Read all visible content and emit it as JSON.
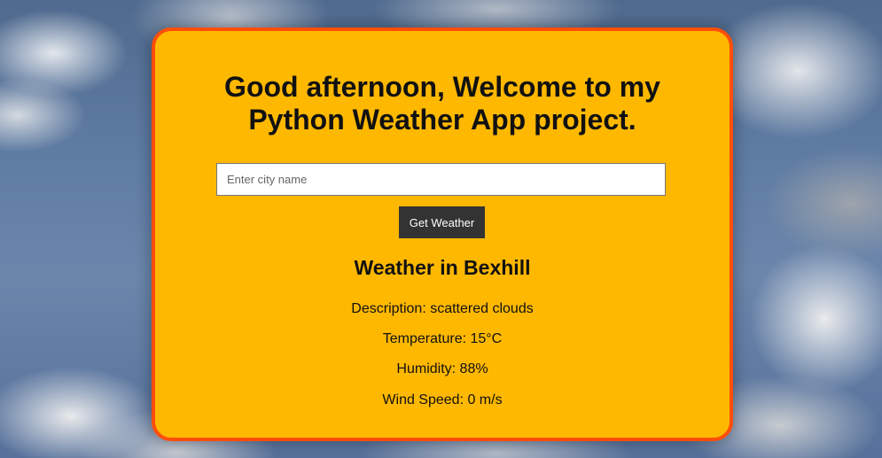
{
  "background": {
    "image": "cloudy-sky"
  },
  "card": {
    "title": "Good afternoon, Welcome to my Python Weather App project.",
    "colors": {
      "background": "#ffb800",
      "border": "#ff4e0a"
    }
  },
  "search": {
    "placeholder": "Enter city name",
    "value": "",
    "button_label": "Get Weather"
  },
  "weather": {
    "heading": "Weather in Bexhill",
    "description": "Description: scattered clouds",
    "temperature": "Temperature: 15°C",
    "humidity": "Humidity: 88%",
    "wind_speed": "Wind Speed: 0 m/s"
  }
}
